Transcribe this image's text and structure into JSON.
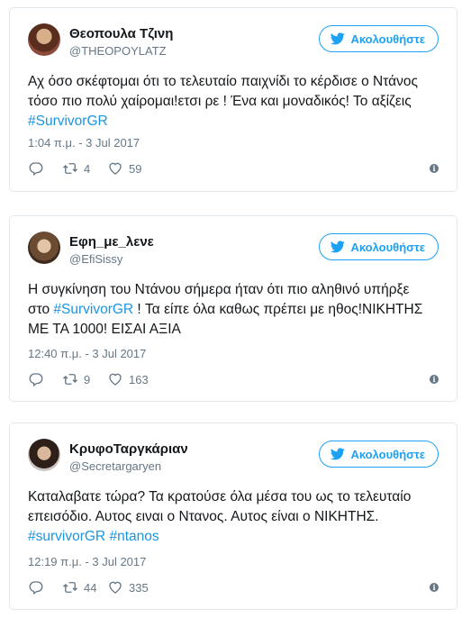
{
  "tweets": [
    {
      "name": "Θεοπουλα Τζινη",
      "handle": "@THEOPOYLATZ",
      "follow_label": "Ακολουθήστε",
      "text_lines": [
        "Αχ όσο σκέφτομαι ότι το τελευταίο παιχνίδι το κέρδισε ο Ντάνος",
        "τόσο πιο πολύ χαίρομαι!ετσι ρε ! Ένα και μοναδικός! Το αξίζεις",
        ""
      ],
      "hashtags": [
        "#SurvivorGR"
      ],
      "timestamp": "1:04 π.μ. - 3 Jul 2017",
      "reply_count": "",
      "retweet_count": "4",
      "like_count": "59"
    },
    {
      "name": "Εφη_με_λενε",
      "handle": "@EfiSissy",
      "follow_label": "Ακολουθήστε",
      "line1": "Η συγκίνηση του Ντάνου σήμερα ήταν ότι πιο αληθινό υπήρξε",
      "line2_pre": "στο ",
      "line2_hashtag": "#SurvivorGR",
      "line2_post": " ! Τα είπε όλα καθως πρέπει με ηθος!ΝΙΚΗΤΗΣ",
      "line3": "ΜΕ ΤΑ 1000! ΕΙΣΑΙ ΑΞΙΑ",
      "timestamp": "12:40 π.μ. - 3 Jul 2017",
      "reply_count": "",
      "retweet_count": "9",
      "like_count": "163"
    },
    {
      "name": "ΚρυφοΤαργκάριαν",
      "handle": "@Secretargaryen",
      "follow_label": "Ακολουθήστε",
      "line1": "Καταλαβατε τώρα? Τα κρατούσε όλα μέσα του ως το τελευταίο",
      "line2": "επεισόδιο. Αυτος ειναι ο Ντανος. Αυτος είναι ο ΝΙΚΗΤΗΣ.",
      "hashtags": [
        "#survivorGR",
        "#ntanos"
      ],
      "timestamp": "12:19 π.μ. - 3 Jul 2017",
      "reply_count": "",
      "retweet_count": "44",
      "like_count": "335"
    }
  ],
  "icons": {
    "follow": "twitter-bird-icon",
    "reply": "reply-icon",
    "retweet": "retweet-icon",
    "like": "heart-icon",
    "info": "info-icon"
  },
  "colors": {
    "accent": "#1da1f2",
    "hashtag": "#1b95e0",
    "muted": "#657786",
    "border": "#e1e8ed"
  }
}
